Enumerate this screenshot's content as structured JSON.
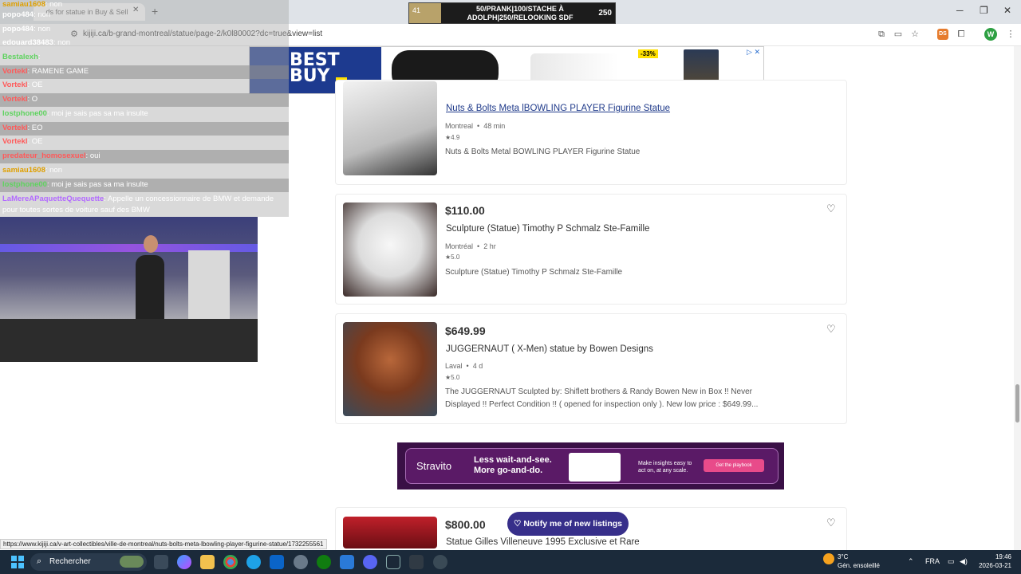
{
  "browser": {
    "tab_title": "...ds for statue in Buy & Sell",
    "url": "kijiji.ca/b-grand-montreal/statue/page-2/k0l80002?dc=true&view=list",
    "status_url": "https://www.kijiji.ca/v-art-collectibles/ville-de-montreal/nuts-bolts-meta-lbowling-player-figurine-statue/1732255561"
  },
  "overlay": {
    "donation_level": "41",
    "donation_text": "50/PRANK|100/STACHE À ADOLPH|250/RELOOKING SDF",
    "donation_goal": "250"
  },
  "ad_banner": {
    "brand": "BEST BUY",
    "discount": "-33%"
  },
  "chat": [
    {
      "name": "samiau1608",
      "msg": ": non"
    },
    {
      "name": "popo484",
      "msg": ": non"
    },
    {
      "name": "popo484",
      "msg": ": non"
    },
    {
      "name": "edouard38483",
      "msg": ": non"
    },
    {
      "name": "Bestalexh",
      "msg": ":"
    },
    {
      "name": "Vortekl",
      "msg": ": RAMENE GAME"
    },
    {
      "name": "Vortekl",
      "msg": ": OE"
    },
    {
      "name": "Vortekl",
      "msg": ": O"
    },
    {
      "name": "lostphone00",
      "msg": ": moi je sais pas sa ma insulte"
    },
    {
      "name": "Vortekl",
      "msg": ": EO"
    },
    {
      "name": "Vortekl",
      "msg": ": OE"
    },
    {
      "name": "predateur_homosexuel",
      "msg": ": oui"
    },
    {
      "name": "samiau1608",
      "msg": ": non"
    },
    {
      "name": "lostphone00",
      "msg": ": moi je sais pas sa ma insulte"
    },
    {
      "name": "LaMereAPaquetteQuequette",
      "msg": ": Appelle un concessionnaire de BMW et demande"
    },
    {
      "name": "",
      "msg": "pour toutes sortes de voiture sauf des BMW"
    }
  ],
  "listings": [
    {
      "title": "Nuts & Bolts Meta lBOWLING PLAYER Figurine Statue",
      "location": "Montreal",
      "time": "48 min",
      "rating": "★4.9",
      "desc": "Nuts & Bolts Metal BOWLING PLAYER Figurine Statue"
    },
    {
      "price": "$110.00",
      "title": "Sculpture (Statue) Timothy P Schmalz Ste-Famille",
      "location": "Montréal",
      "time": "2 hr",
      "rating": "★5.0",
      "desc": "Sculpture (Statue) Timothy P Schmalz Ste-Famille"
    },
    {
      "price": "$649.99",
      "title": "JUGGERNAUT ( X-Men) statue by Bowen Designs",
      "location": "Laval",
      "time": "4 d",
      "rating": "★5.0",
      "desc": "The JUGGERNAUT Sculpted by: Shiflett brothers & Randy Bowen New in Box !! Never Displayed !! Perfect Condition !! ( opened for inspection only ). New low price : $649.99..."
    },
    {
      "price": "$800.00",
      "title": "Statue Gilles Villeneuve 1995 Exclusive et Rare"
    }
  ],
  "separator_dot": "•",
  "stravito": {
    "logo": "Stravito",
    "headline": "Less wait-and-see. More go-and-do.",
    "sub": "Make insights easy to act on, at any scale.",
    "cta": "Get the playbook"
  },
  "notify_label": "♡ Notify me of new listings",
  "taskbar": {
    "search": "Rechercher",
    "weather_temp": "3°C",
    "weather_desc": "Gén. ensoleillé",
    "lang": "FRA",
    "time": "19:46",
    "date": "2026-03-21"
  },
  "colors": {
    "kijiji_navy": "#372f8a",
    "link_blue": "#1f3a8a",
    "bestbuy_blue": "#1d3a8f",
    "bestbuy_yellow": "#ffe000"
  }
}
